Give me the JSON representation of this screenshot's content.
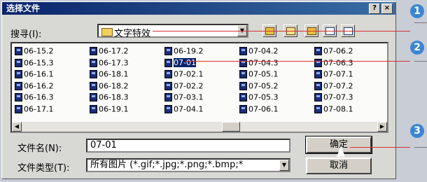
{
  "dialog": {
    "title": "选择文件",
    "help_btn": "?",
    "close_btn": "×"
  },
  "lookin": {
    "label": "搜寻(I):",
    "value": "文字特效"
  },
  "files": [
    "06-15.2",
    "06-17.2",
    "06-19.2",
    "07-04.2",
    "07-06.2",
    "06-15.3",
    "06-17.3",
    "07-01",
    "07-04.3",
    "07-06.3",
    "06-16.1",
    "06-18.1",
    "07-02.1",
    "07-05.1",
    "07-07.1",
    "06-16.2",
    "06-18.2",
    "07-02.2",
    "07-05.2",
    "07-07.2",
    "06-16.3",
    "06-18.3",
    "07-03.1",
    "07-05.3",
    "07-07.3",
    "06-17.1",
    "06-19.1",
    "07-04.1",
    "07-06.1",
    "07-08.1"
  ],
  "selected_file": "07-01",
  "filename": {
    "label": "文件名(N):",
    "value": "07-01"
  },
  "filetype": {
    "label": "文件类型(T):",
    "value": "所有图片 (*.gif;*.jpg;*.png;*.bmp;*"
  },
  "buttons": {
    "ok": "确定",
    "cancel": "取消"
  },
  "markers": [
    "1",
    "2",
    "3"
  ],
  "colors": {
    "title_start": "#0a246a",
    "marker": "#3b86d4",
    "leader": "#d83030"
  }
}
